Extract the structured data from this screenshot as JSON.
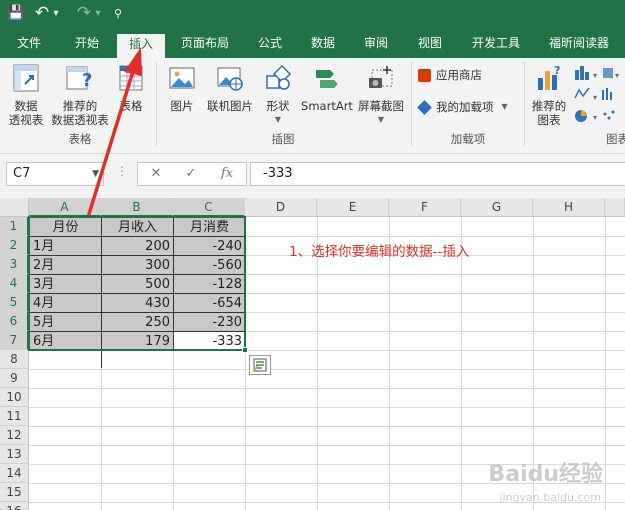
{
  "quick_access": {
    "save": "💾",
    "undo": "↶",
    "undo_dd": "▾",
    "redo": "↷",
    "redo_dd": "▾",
    "customize": "⚲"
  },
  "tabs": [
    "文件",
    "开始",
    "插入",
    "页面布局",
    "公式",
    "数据",
    "审阅",
    "视图",
    "开发工具",
    "福昕阅读器"
  ],
  "active_tab": "插入",
  "ribbon": {
    "pivot": "数据\n透视表",
    "recommended_pivot": "推荐的\n数据透视表",
    "table": "表格",
    "group_tables": "表格",
    "picture": "图片",
    "online_picture": "联机图片",
    "shapes": "形状",
    "smartart": "SmartArt",
    "screenshot": "屏幕截图",
    "group_illustrations": "插图",
    "store": "应用商店",
    "my_addins": "我的加载项",
    "group_addins": "加载项",
    "recommended_charts": "推荐的\n图表",
    "group_charts": "图表"
  },
  "formula_bar": {
    "name_box": "C7",
    "cancel": "✕",
    "enter": "✓",
    "fx": "fx",
    "value": "-333"
  },
  "columns": [
    "A",
    "B",
    "C",
    "D",
    "E",
    "F",
    "G",
    "H"
  ],
  "rows": [
    "1",
    "2",
    "3",
    "4",
    "5",
    "6",
    "7",
    "8",
    "9",
    "10",
    "11",
    "12",
    "13",
    "14",
    "15",
    "16"
  ],
  "table": {
    "headers": [
      "月份",
      "月收入",
      "月消费"
    ],
    "rows": [
      [
        "1月",
        "200",
        "-240"
      ],
      [
        "2月",
        "300",
        "-560"
      ],
      [
        "3月",
        "500",
        "-128"
      ],
      [
        "4月",
        "430",
        "-654"
      ],
      [
        "5月",
        "250",
        "-230"
      ],
      [
        "6月",
        "179",
        "-333"
      ]
    ]
  },
  "annotation": "1、选择你要编辑的数据--插入",
  "watermark": "Baidu经验",
  "watermark_sub": "jingyan.baidu.com",
  "colors": {
    "excel_green": "#217346",
    "annotation_red": "#e0302a",
    "selection_fill": "#c9c9c9"
  }
}
